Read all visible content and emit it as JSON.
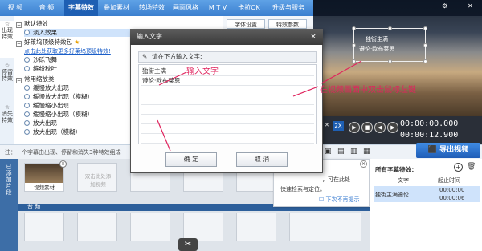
{
  "menu": {
    "items": [
      "视  频",
      "音  频",
      "字幕特效",
      "叠加素材",
      "转场特效",
      "画面风格",
      "M T V",
      "卡拉OK",
      "升级与服务"
    ],
    "active_index": 2
  },
  "sidebar_tabs": [
    "出现特效",
    "停留特效",
    "消失特效"
  ],
  "effects": {
    "group_default": "默认特效",
    "default_items": [
      "淡入效果"
    ],
    "group_recommended": "好莱坞顶级特效包",
    "recommended_link": "点击此处获取更多好莱坞顶级特效!",
    "recommended_items": [
      "沙砾飞舞",
      "缤纷秋叶"
    ],
    "group_common": "常用缩放类",
    "common_items": [
      "缓慢放大出现",
      "缓慢放大出现（模糊）",
      "缓慢缩小出现",
      "缓慢缩小出现（模糊）",
      "放大出现",
      "放大出现（模糊）"
    ]
  },
  "subtabs": {
    "font": "字体设置",
    "params": "特效参数"
  },
  "preview": {
    "subtitle_line1": "独街主满",
    "subtitle_line2": "遵伦·欧布莱思"
  },
  "player": {
    "speed": "2X",
    "time_current": "00:00:00.000",
    "time_total": "00:00:12.900"
  },
  "note": "注：一个字幕由出现、停留和消失3种特效组成",
  "export_label": "导出视频",
  "timeline": {
    "side_label": "已添加片段",
    "clip_label": "视频素材",
    "placeholder": "双击此处添加视频",
    "audio_label": "音 频",
    "cut_icon": "✂"
  },
  "tooltip": {
    "text1": "，可在此处",
    "text2": "快速检索与定位。",
    "dont_show": "下次不再提示"
  },
  "subs_panel": {
    "title": "所有字幕特效：",
    "col_text": "文字",
    "col_start": "起止时间",
    "row_text": "独街主满遵伦...",
    "row_start": "00:00:00",
    "row_end": "00:00:06"
  },
  "dialog": {
    "title": "输入文字",
    "close": "×",
    "prompt": "请在下方输入文字:",
    "lines": [
      "独街主满",
      "遵伦·欧布莱恩",
      "",
      "",
      "",
      "",
      "",
      ""
    ],
    "ok": "确  定",
    "cancel": "取  消"
  },
  "annotations": {
    "input_hint": "输入文字",
    "double_click_hint": "在视频画面中双击鼠标左键"
  }
}
